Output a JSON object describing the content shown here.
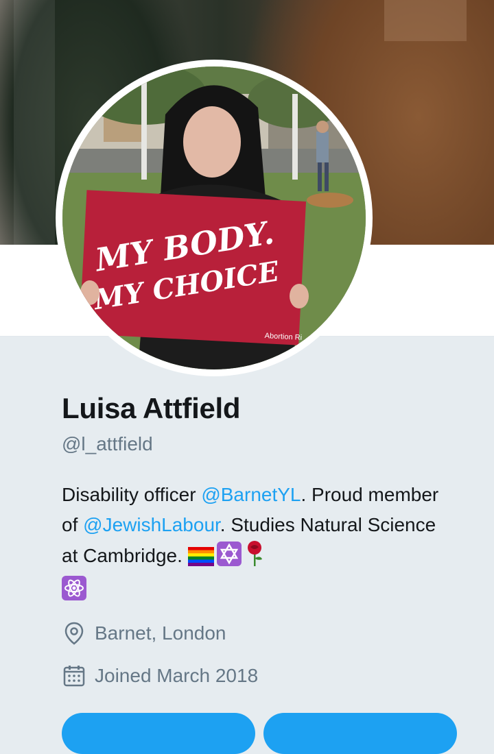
{
  "profile": {
    "name": "Luisa Attfield",
    "handle": "@l_attfield",
    "avatar_sign_line1": "MY BODY.",
    "avatar_sign_line2": "MY CHOICE",
    "avatar_sign_footer": "Abortion Ri",
    "bio": {
      "part1": "Disability officer ",
      "mention1": "@BarnetYL",
      "part2": ". Proud member of ",
      "mention2": "@JewishLabour",
      "part3": ". Studies Natural Science at Cambridge. ",
      "emojis": [
        "rainbow-flag-emoji",
        "star-of-david-emoji",
        "rose-emoji",
        "atom-symbol-emoji"
      ]
    },
    "location": "Barnet, London",
    "joined": "Joined March 2018"
  },
  "colors": {
    "accent": "#1da1f2",
    "text": "#14171a",
    "muted": "#657786",
    "background": "#e6ecf0"
  }
}
